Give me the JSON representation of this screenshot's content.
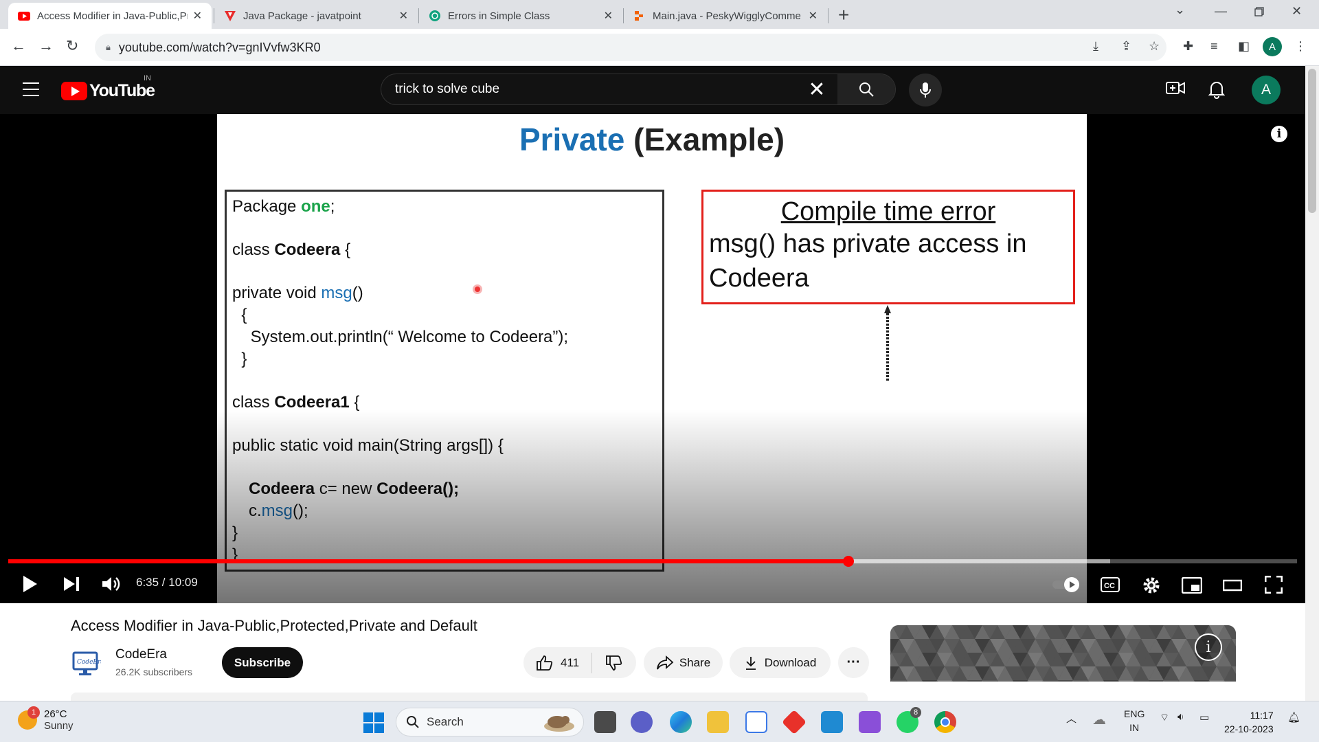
{
  "browser": {
    "tabs": [
      {
        "title": "Access Modifier in Java-Public,Pr",
        "favicon": "youtube-icon",
        "active": true
      },
      {
        "title": "Java Package - javatpoint",
        "favicon": "javatpoint-icon",
        "active": false
      },
      {
        "title": "Errors in Simple Class",
        "favicon": "chatgpt-icon",
        "active": false
      },
      {
        "title": "Main.java - PeskyWigglyComme",
        "favicon": "replit-icon",
        "active": false
      }
    ],
    "url": "youtube.com/watch?v=gnIVvfw3KR0",
    "profile_initial": "A"
  },
  "youtube": {
    "logo_text": "YouTube",
    "region": "IN",
    "search_query": "trick to solve cube",
    "avatar_initial": "A"
  },
  "slide": {
    "title_blue": "Private",
    "title_rest": " (Example)",
    "code": {
      "l1_a": "Package ",
      "l1_b": "one",
      "l1_c": ";",
      "l2_a": "class ",
      "l2_b": "Codeera",
      "l2_c": " {",
      "l3_a": "private void ",
      "l3_b": "msg",
      "l3_c": "()",
      "l4": "  {",
      "l5": "    System.out.println(“ Welcome to Codeera”);",
      "l6": "  }",
      "l7_a": "class ",
      "l7_b": "Codeera1",
      "l7_c": " {",
      "l8": "public static void main(String args[]) {",
      "l9_a": "Codeera",
      "l9_b": " c= new ",
      "l9_c": "Codeera();",
      "l10_a": "c.",
      "l10_b": "msg",
      "l10_c": "();",
      "l11": "}",
      "l12": "}"
    },
    "error_heading": "Compile time error",
    "error_line1": "msg() has private access in",
    "error_line2": "Codeera"
  },
  "player": {
    "time": "6:35 / 10:09",
    "progress": 0.652,
    "buffered": 0.855
  },
  "video": {
    "title": "Access Modifier in Java-Public,Protected,Private and Default",
    "channel": "CodeEra",
    "subscribers": "26.2K subscribers",
    "subscribe_label": "Subscribe",
    "likes": "411",
    "share_label": "Share",
    "download_label": "Download"
  },
  "taskbar": {
    "temperature": "26°C",
    "weather": "Sunny",
    "weather_badge": "1",
    "search_label": "Search",
    "whatsapp_badge": "8",
    "lang_line1": "ENG",
    "lang_line2": "IN",
    "time": "11:17",
    "date": "22-10-2023"
  }
}
